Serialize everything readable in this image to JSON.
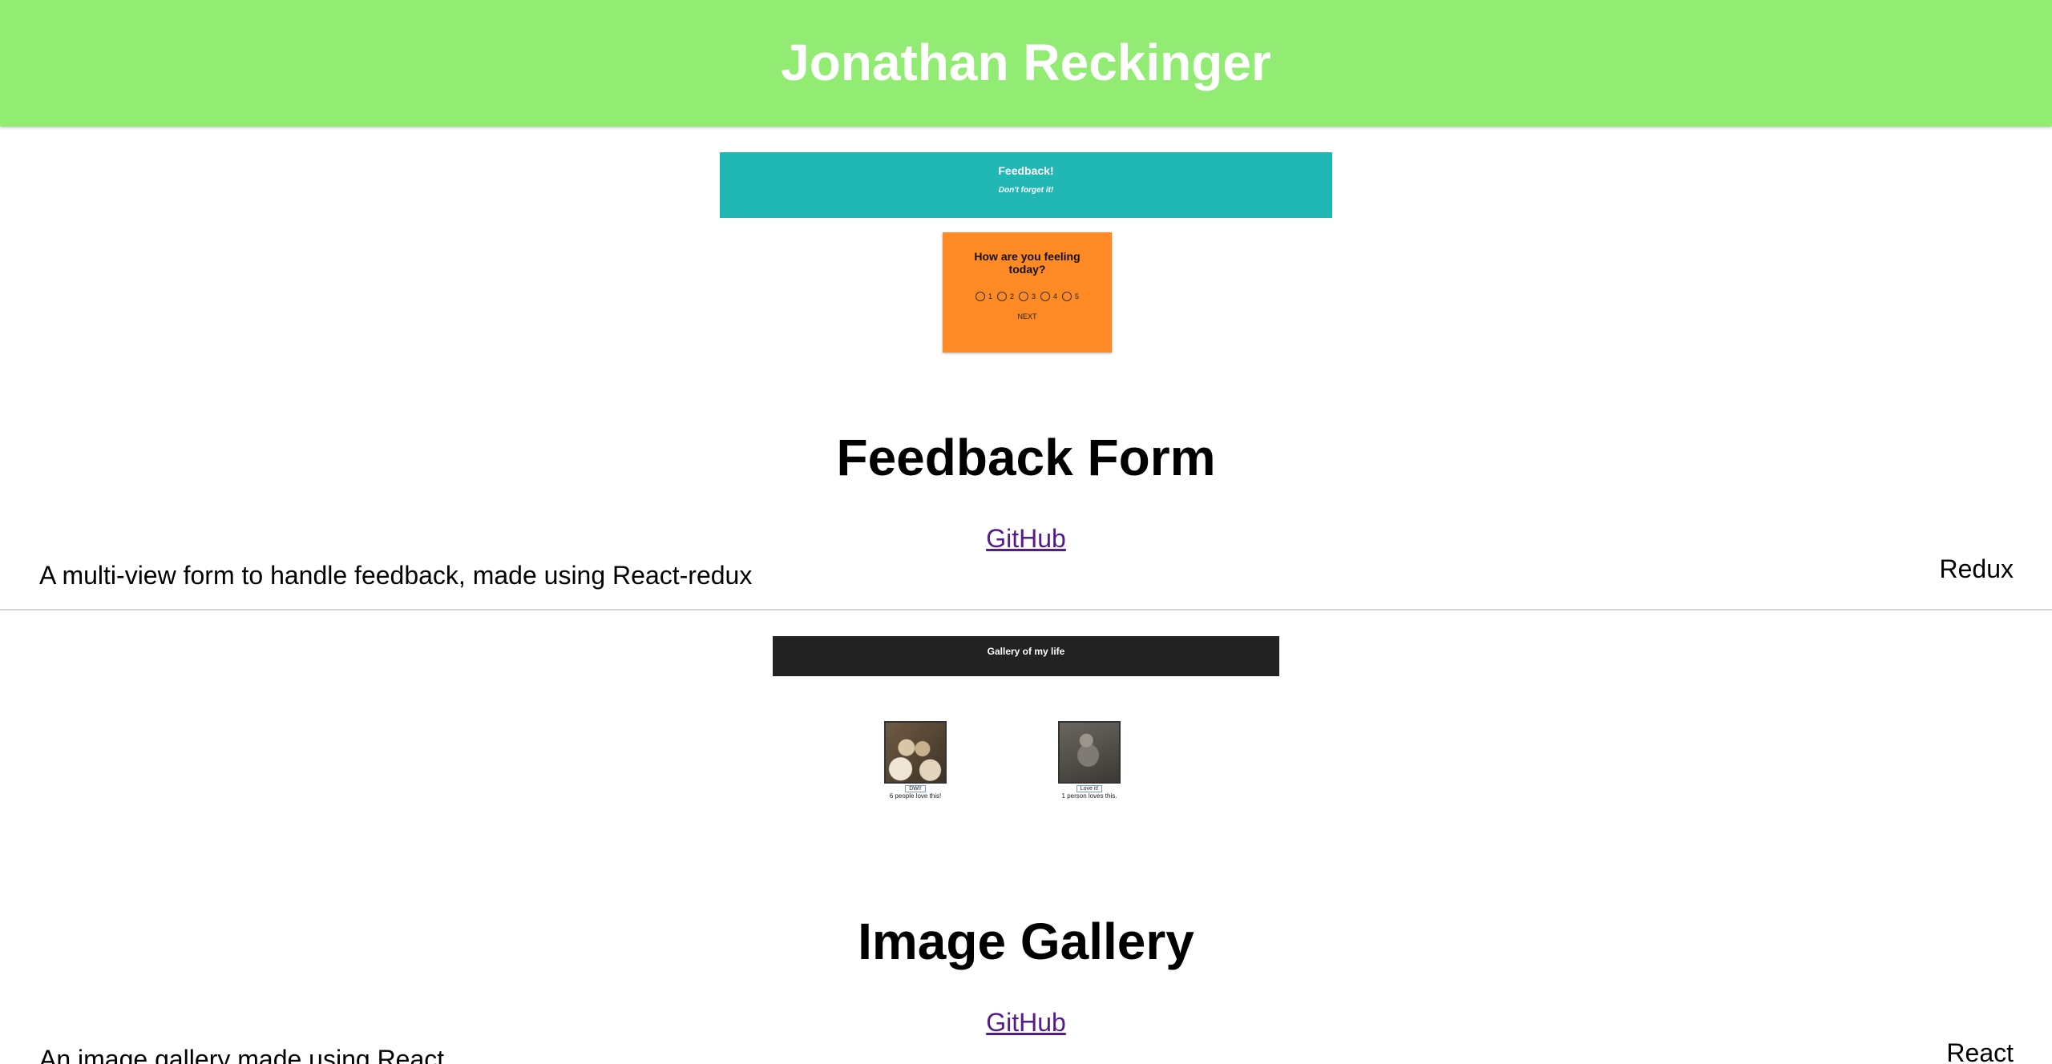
{
  "header": {
    "title": "Jonathan Reckinger"
  },
  "projects": [
    {
      "title": "Feedback Form",
      "link_label": "GitHub",
      "description": "A multi-view form to handle feedback, made using React-redux",
      "tag": "Redux",
      "preview": {
        "banner_title": "Feedback!",
        "banner_subtitle": "Don't forget it!",
        "question": "How are you feeling today?",
        "options": [
          "1",
          "2",
          "3",
          "4",
          "5"
        ],
        "next_label": "NEXT",
        "colors": {
          "banner": "#20b7b5",
          "card": "#fd8a25"
        }
      }
    },
    {
      "title": "Image Gallery",
      "link_label": "GitHub",
      "description": "An image gallery made using React",
      "tag": "React",
      "preview": {
        "banner_title": "Gallery of my life",
        "items": [
          {
            "button_label": "DWI!",
            "likes_text": "6 people love this!"
          },
          {
            "button_label": "Love it!",
            "likes_text": "1 person loves this."
          }
        ],
        "colors": {
          "banner": "#222222"
        }
      }
    }
  ],
  "colors": {
    "header_bg": "#92ec73",
    "link": "#551a8b"
  }
}
